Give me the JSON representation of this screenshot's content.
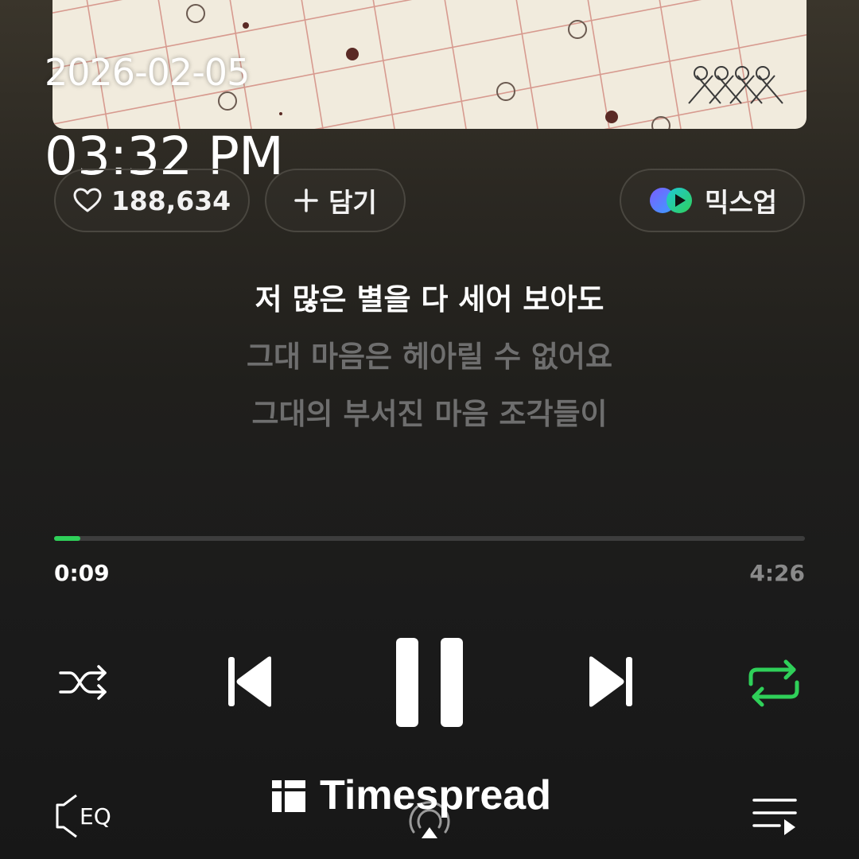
{
  "status": {
    "date": "2026-02-05",
    "time": "03:32 PM"
  },
  "actions": {
    "like_count": "188,634",
    "add_label": "담기",
    "mixup_label": "믹스업"
  },
  "lyrics": [
    "저 많은 별을 다 세어 보아도",
    "그대 마음은 헤아릴 수 없어요",
    "그대의 부서진 마음 조각들이"
  ],
  "player": {
    "current_time": "0:09",
    "total_time": "4:26",
    "progress": 0.035,
    "repeat_active": true
  },
  "bottom": {
    "eq_label": "EQ"
  },
  "watermark": {
    "text": "Timespread"
  },
  "colors": {
    "accent_green": "#2fd059",
    "inactive_lyric": "#6e6e6e"
  },
  "icons": {
    "like": "heart-icon",
    "add": "plus-icon",
    "mixup": "mixup-icon",
    "shuffle": "shuffle-icon",
    "prev": "skip-previous-icon",
    "pause": "pause-icon",
    "next": "skip-next-icon",
    "repeat": "repeat-icon",
    "eq": "eq-icon",
    "cast": "cast-icon",
    "queue": "queue-icon"
  }
}
